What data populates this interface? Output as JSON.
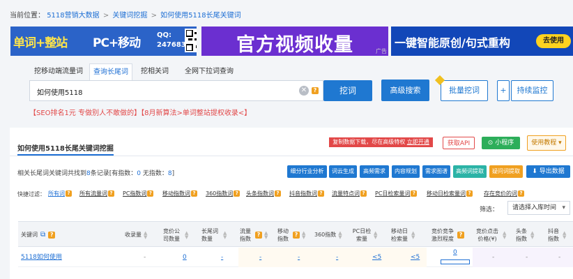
{
  "breadcrumb": {
    "prefix": "当前位置：",
    "items": [
      "5118营销大数据",
      "关键词挖掘",
      "如何使用5118长尾关键词"
    ],
    "sep": ">"
  },
  "banners": {
    "b1_part1": "单词+整站",
    "b1_part2": "PC+移动",
    "b1_qq_label": "QQ:",
    "b1_qq_number": "247683",
    "b2_text": "官方视频收量",
    "b2_ad": "广告",
    "b3_text": "一键智能原创/句式重构",
    "b3_button": "去使用"
  },
  "tabs": [
    "挖移动端流量词",
    "查询长尾词",
    "挖相关词",
    "全网下拉词查询"
  ],
  "search": {
    "value": "如何使用5118",
    "dig_button": "挖词",
    "advanced_button": "高级搜索",
    "batch_button": "批量挖词",
    "plus": "+",
    "monitor_button": "持续监控"
  },
  "promo": "【SEO排名1元 专做别人不敢做的】【8月新算法>单词整站提权收录<】",
  "card": {
    "title": "如何使用5118长尾关键词挖掘",
    "red_tag_text": "复制数据下载，尽在高级特权",
    "red_tag_link": "立即开通",
    "api_button": "获取API",
    "mini_button": "小程序",
    "tutorial_button": "使用教程",
    "stats_prefix": "相关长尾词关键词共找到",
    "stats_count": "8",
    "stats_mid": "条记录[有指数：",
    "stats_index": "0",
    "stats_mid2": "无指数：",
    "stats_noindex": "8",
    "stats_end": "]",
    "tool_buttons": [
      {
        "label": "细分行业分析",
        "color": "#1f78d1"
      },
      {
        "label": "词云生成",
        "color": "#1f78d1"
      },
      {
        "label": "高频需求",
        "color": "#1f78d1"
      },
      {
        "label": "内容规划",
        "color": "#1f78d1"
      },
      {
        "label": "需求图谱",
        "color": "#1f78d1"
      },
      {
        "label": "高频词提取",
        "color": "#2bb3a6"
      },
      {
        "label": "疑问词提取",
        "color": "#f0a020"
      },
      {
        "label": "导出数据",
        "color": "#1f78d1"
      }
    ],
    "filter_label": "快捷过滤：",
    "filters": [
      "所有词",
      "所有流量词",
      "PC指数词",
      "移动指数词",
      "360指数词",
      "头条指数词",
      "抖音指数词",
      "流量特点词",
      "PC日检索量词",
      "移动日检索量词",
      "存在竞价的词"
    ],
    "filter_label_2": "筛选：",
    "select_placeholder": "请选择入库时间"
  },
  "table": {
    "headers": [
      "关键词",
      "收录量",
      "竞价公司数量",
      "长尾词数量",
      "流量指数",
      "移动指数",
      "360指数",
      "PC日检索量",
      "移动日检索量",
      "竞价竞争激烈程度",
      "竞价点击价格(¥)",
      "头条指数",
      "抖音指数"
    ],
    "rows": [
      {
        "keyword": "5118如何使用",
        "values": [
          "-",
          "0",
          "-",
          "-",
          "-",
          "-",
          "<5",
          "<5",
          "0",
          "-",
          "-",
          "-"
        ]
      }
    ]
  },
  "colors": {
    "accent": "#1e6fd4",
    "promo": "#e24848",
    "tutorial": "#f0a020"
  }
}
